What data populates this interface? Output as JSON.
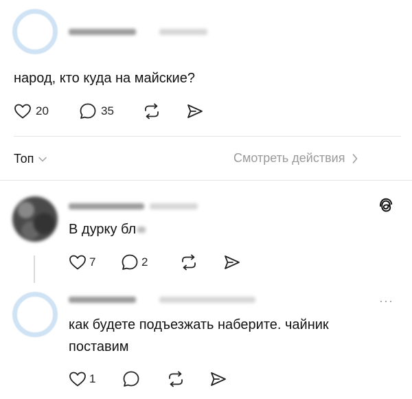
{
  "main_post": {
    "text": "народ, кто куда на майские?",
    "likes": "20",
    "replies": "35"
  },
  "sort_bar": {
    "sort_label": "Топ",
    "activity_link": "Смотреть действия"
  },
  "reply_1": {
    "text": "В дурку бл",
    "likes": "7",
    "replies": "2"
  },
  "reply_2": {
    "text_line1": "как будете подъезжать наберите. чайник",
    "text_line2": "поставим",
    "likes": "1",
    "more_menu": "···"
  },
  "icons": {
    "like": "heart-icon",
    "reply": "speech-bubble-icon",
    "repost": "repost-icon",
    "share": "send-icon",
    "threads": "threads-logo-icon",
    "chevron": "chevron-icon"
  }
}
